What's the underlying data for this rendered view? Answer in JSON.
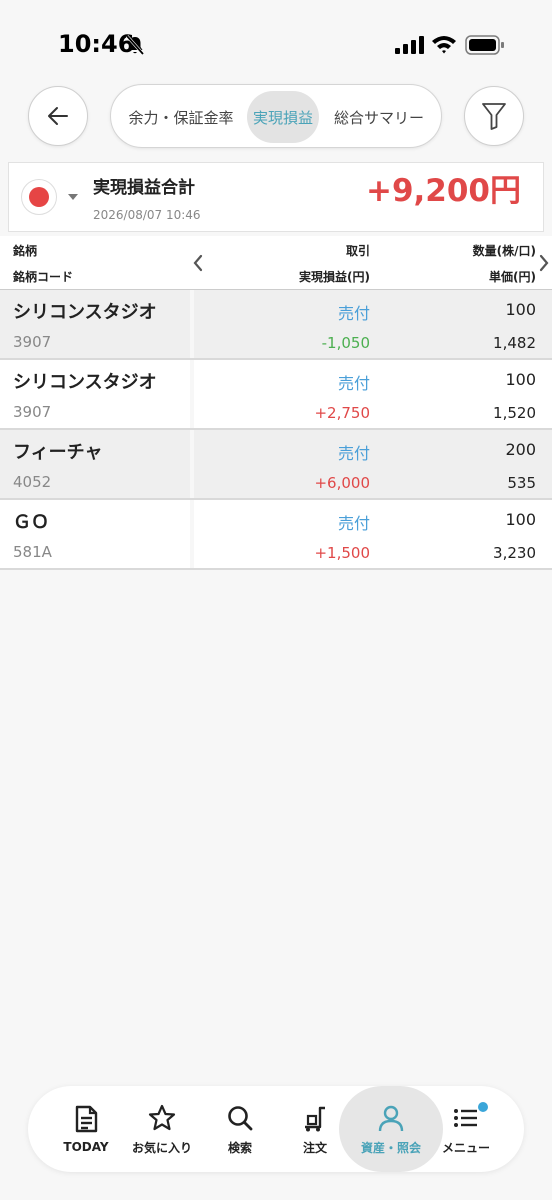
{
  "status_bar": {
    "time": "10:46"
  },
  "header": {
    "tabs": [
      {
        "label": "余力・保証金率"
      },
      {
        "label": "実現損益"
      },
      {
        "label": "総合サマリー"
      }
    ]
  },
  "summary": {
    "title": "実現損益合計",
    "date": "2026/08/07 10:46",
    "total": "+9,200円"
  },
  "table": {
    "headers": {
      "name": "銘柄",
      "code": "銘柄コード",
      "trade": "取引",
      "pnl": "実現損益(円)",
      "qty": "数量(株/口)",
      "price": "単価(円)"
    },
    "rows": [
      {
        "name": "シリコンスタジオ",
        "code": "3907",
        "trade": "売付",
        "pnl": "-1,050",
        "qty": "100",
        "price": "1,482"
      },
      {
        "name": "シリコンスタジオ",
        "code": "3907",
        "trade": "売付",
        "pnl": "+2,750",
        "qty": "100",
        "price": "1,520"
      },
      {
        "name": "フィーチャ",
        "code": "4052",
        "trade": "売付",
        "pnl": "+6,000",
        "qty": "200",
        "price": "535"
      },
      {
        "name": "ＧＯ",
        "code": "581A",
        "trade": "売付",
        "pnl": "+1,500",
        "qty": "100",
        "price": "3,230"
      }
    ]
  },
  "bottom_nav": {
    "items": [
      {
        "label": "TODAY",
        "icon": "document-icon"
      },
      {
        "label": "お気に入り",
        "icon": "star-icon"
      },
      {
        "label": "検索",
        "icon": "search-icon"
      },
      {
        "label": "注文",
        "icon": "cart-icon"
      },
      {
        "label": "資産・照会",
        "icon": "person-icon"
      },
      {
        "label": "メニュー",
        "icon": "list-icon"
      }
    ]
  },
  "colors": {
    "positive": "#e04848",
    "negative": "#4caf50",
    "trade": "#4a9fd8",
    "accent": "#4aa3b8"
  }
}
